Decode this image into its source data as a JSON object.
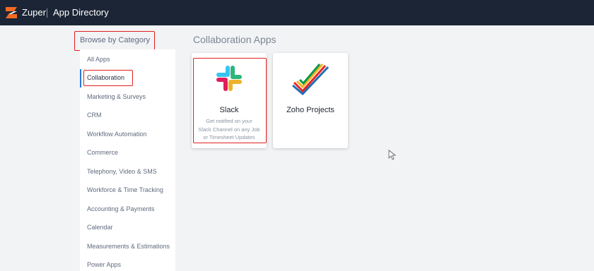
{
  "header": {
    "brand": "Zuper",
    "title": "App Directory"
  },
  "sidebar": {
    "heading": "Browse by Category",
    "items": [
      {
        "label": "All Apps"
      },
      {
        "label": "Collaboration",
        "active": true
      },
      {
        "label": "Marketing & Surveys"
      },
      {
        "label": "CRM"
      },
      {
        "label": "Workflow Automation"
      },
      {
        "label": "Commerce"
      },
      {
        "label": "Telephony, Video & SMS"
      },
      {
        "label": "Workforce & Time Tracking"
      },
      {
        "label": "Accounting & Payments"
      },
      {
        "label": "Calendar"
      },
      {
        "label": "Measurements & Estimations"
      },
      {
        "label": "Power Apps"
      }
    ]
  },
  "main": {
    "title": "Collaboration Apps",
    "apps": [
      {
        "name": "Slack",
        "icon": "slack-icon",
        "description_lines": [
          "Get notified on your",
          "Slack Channel on any Job",
          "or Timesheet Updates"
        ]
      },
      {
        "name": "Zoho Projects",
        "icon": "zoho-projects-icon"
      }
    ]
  },
  "colors": {
    "topbar": "#1b2535",
    "accent": "#2a78d4",
    "highlight": "#e02020",
    "background": "#f2f3f5"
  }
}
